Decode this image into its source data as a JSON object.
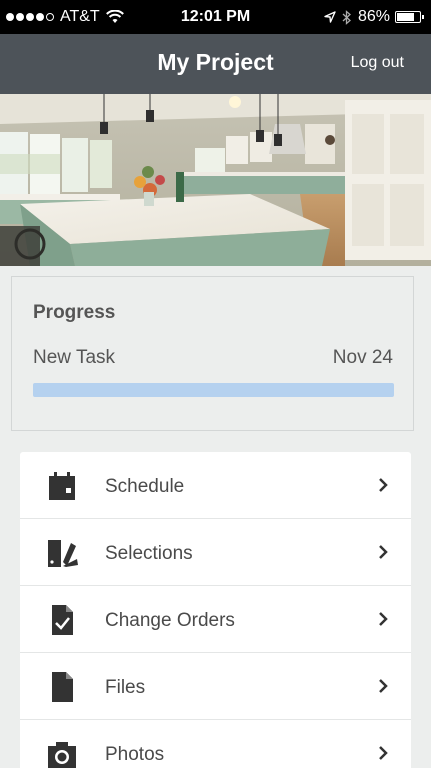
{
  "status_bar": {
    "carrier": "AT&T",
    "time": "12:01 PM",
    "battery_percent": "86%",
    "battery_level": 0.86
  },
  "header": {
    "title": "My Project",
    "logout_label": "Log out"
  },
  "progress": {
    "heading": "Progress",
    "task_name": "New Task",
    "task_date": "Nov 24",
    "fill_fraction": 1.0,
    "bar_color": "#b5d1ef"
  },
  "menu": {
    "items": [
      {
        "label": "Schedule",
        "icon": "calendar-icon"
      },
      {
        "label": "Selections",
        "icon": "swatch-icon"
      },
      {
        "label": "Change Orders",
        "icon": "document-check-icon"
      },
      {
        "label": "Files",
        "icon": "file-icon"
      },
      {
        "label": "Photos",
        "icon": "camera-icon"
      }
    ]
  },
  "colors": {
    "nav_background": "#4d5359",
    "page_background": "#eceeed",
    "icon_color": "#333333"
  }
}
